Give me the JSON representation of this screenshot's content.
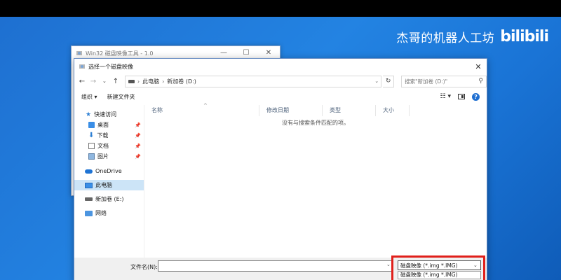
{
  "watermark": {
    "text": "杰哥的机器人工坊",
    "logo": "bilibili"
  },
  "back_window": {
    "title": "Win32 磁盘映像工具 - 1.0",
    "buttons": {
      "minimize": "—",
      "maximize": "☐",
      "close": "✕"
    }
  },
  "dialog": {
    "title": "选择一个磁盘映像",
    "close": "✕",
    "nav": {
      "back": "←",
      "forward": "→",
      "dropdown": "⌄",
      "up": "↑"
    },
    "address": {
      "crumbs": [
        "此电脑",
        "新加卷 (D:)"
      ],
      "sep": "›",
      "dropdown": "⌄",
      "refresh": "↻"
    },
    "search": {
      "placeholder": "搜索\"新加卷 (D:)\"",
      "icon": "⚲"
    },
    "toolbar": {
      "organize": "组织 ▾",
      "new_folder": "新建文件夹",
      "view": "☷ ▾",
      "help": "?"
    },
    "sidebar": {
      "items": [
        {
          "label": "快速访问",
          "icon": "star-icon"
        },
        {
          "label": "桌面",
          "icon": "desktop-icon",
          "pin": "📌"
        },
        {
          "label": "下载",
          "icon": "download-icon",
          "pin": "📌"
        },
        {
          "label": "文档",
          "icon": "document-icon",
          "pin": "📌"
        },
        {
          "label": "图片",
          "icon": "pictures-icon",
          "pin": "📌"
        },
        {
          "label": "OneDrive",
          "icon": "cloud-icon"
        },
        {
          "label": "此电脑",
          "icon": "computer-icon"
        },
        {
          "label": "新加卷 (E:)",
          "icon": "drive-icon"
        },
        {
          "label": "网络",
          "icon": "network-icon"
        }
      ]
    },
    "columns": [
      "名称",
      "修改日期",
      "类型",
      "大小"
    ],
    "sort_caret": "^",
    "empty_message": "没有与搜索条件匹配的项。",
    "bottom": {
      "filename_label": "文件名(N):",
      "filename_value": "",
      "filename_dropdown": "⌄",
      "filter_selected": "磁盘映像 (*.img *.IMG)",
      "filter_caret": "⌄",
      "filter_option": "磁盘映像 (*.img *.IMG)"
    }
  },
  "colors": {
    "highlight": "#e0201b",
    "desktop": "#1e78d8",
    "selected": "#cce4f7"
  }
}
